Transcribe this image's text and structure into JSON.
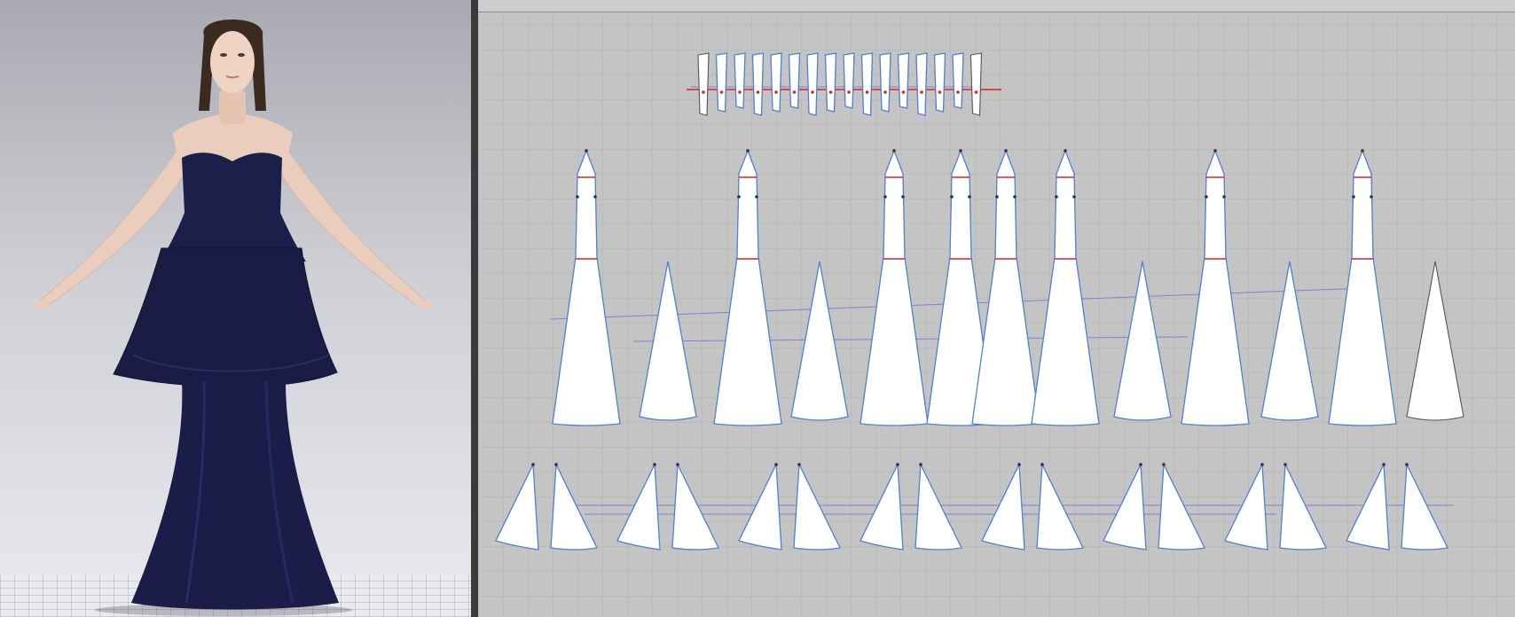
{
  "app": {
    "panels": {
      "viewport_3d": {
        "background_top": "#a9a9b1",
        "background_bottom": "#e9e9ef"
      },
      "pattern_2d": {
        "background": "#c4c4c4",
        "grid_color": "#b4b4b4"
      }
    },
    "garment": {
      "fabric_color": "#1c1f4a",
      "skin_color": "#ebcdbd",
      "hair_color": "#3a2a20"
    },
    "pattern_pieces": {
      "stroke_color": "#4f7fd6",
      "sewing_line_color": "#6a6ad8",
      "notch_color": "#d22222",
      "rows": {
        "small_strips": 16,
        "long_panels": 13,
        "flounce_wedges": 16
      }
    },
    "icons": [
      "avatar-figure",
      "pattern-piece"
    ]
  }
}
